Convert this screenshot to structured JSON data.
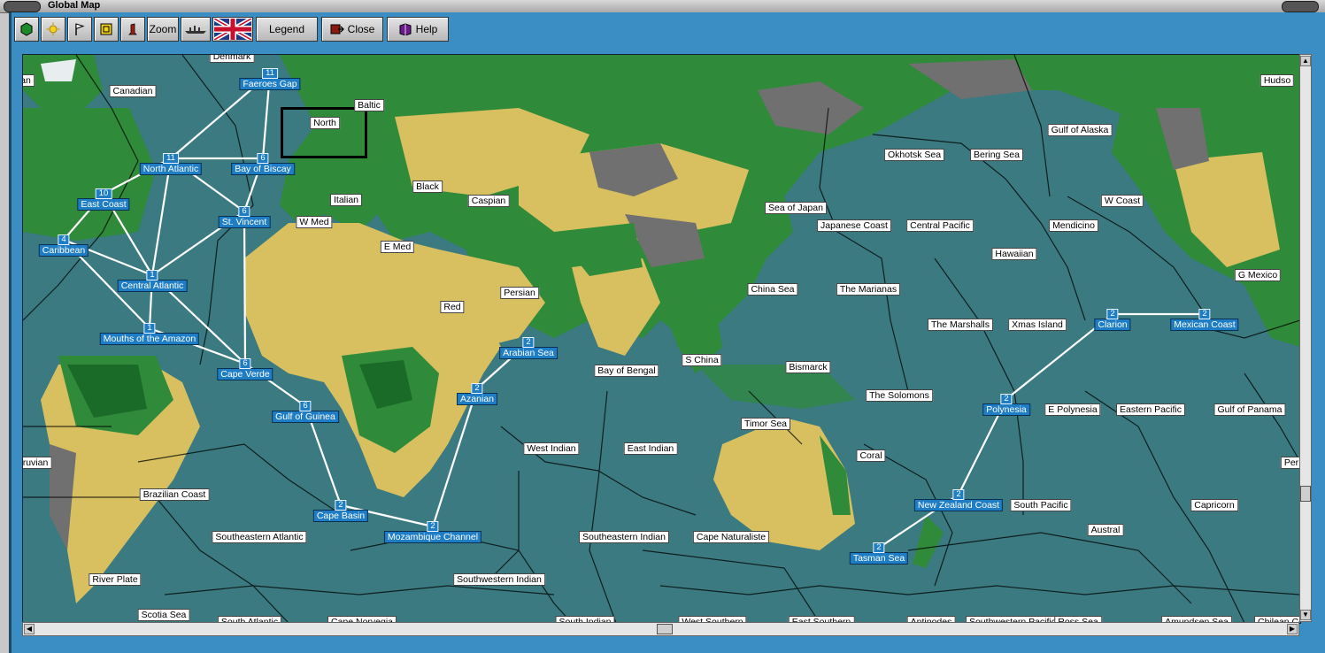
{
  "window": {
    "title": "Global Map"
  },
  "toolbar": {
    "zoom_label": "Zoom",
    "legend_label": "Legend",
    "close_label": "Close",
    "help_label": "Help"
  },
  "colors": {
    "frame": "#3b8ec4",
    "ocean": "#3a7a80",
    "route": "#ffffff",
    "zone_blue": "#1e7dc4"
  },
  "map": {
    "plain_labels": [
      {
        "text": "Denmark"
      },
      {
        "text": "Canadian"
      },
      {
        "text": "Baltic"
      },
      {
        "text": "North"
      },
      {
        "text": "Black"
      },
      {
        "text": "Italian"
      },
      {
        "text": "Caspian"
      },
      {
        "text": "W Med"
      },
      {
        "text": "E Med"
      },
      {
        "text": "Persian"
      },
      {
        "text": "Red"
      },
      {
        "text": "Okhotsk Sea"
      },
      {
        "text": "Bering Sea"
      },
      {
        "text": "Gulf of Alaska"
      },
      {
        "text": "Sea of Japan"
      },
      {
        "text": "Japanese Coast"
      },
      {
        "text": "Central Pacific"
      },
      {
        "text": "Mendicino"
      },
      {
        "text": "W Coast"
      },
      {
        "text": "Hawaiian"
      },
      {
        "text": "China Sea"
      },
      {
        "text": "The Marianas"
      },
      {
        "text": "The Marshalls"
      },
      {
        "text": "Xmas Island"
      },
      {
        "text": "G Mexico"
      },
      {
        "text": "Hudso"
      },
      {
        "text": "Bay of Bengal"
      },
      {
        "text": "S China"
      },
      {
        "text": "Bismarck"
      },
      {
        "text": "The Solomons"
      },
      {
        "text": "Timor Sea"
      },
      {
        "text": "E Polynesia"
      },
      {
        "text": "Eastern Pacific"
      },
      {
        "text": "Gulf of Panama"
      },
      {
        "text": "West Indian"
      },
      {
        "text": "East Indian"
      },
      {
        "text": "Coral"
      },
      {
        "text": "Brazilian Coast"
      },
      {
        "text": "South Pacific"
      },
      {
        "text": "Capricorn"
      },
      {
        "text": "Southeastern Atlantic"
      },
      {
        "text": "Southeastern Indian"
      },
      {
        "text": "Cape Naturaliste"
      },
      {
        "text": "Austral"
      },
      {
        "text": "River Plate"
      },
      {
        "text": "Southwestern Indian"
      },
      {
        "text": "Scotia Sea"
      },
      {
        "text": "South Atlantic"
      },
      {
        "text": "Cape Norvegia"
      },
      {
        "text": "South Indian"
      },
      {
        "text": "West Southern"
      },
      {
        "text": "East Southern"
      },
      {
        "text": "Antipodes"
      },
      {
        "text": "Southwestern Pacific"
      },
      {
        "text": "Ross Sea"
      },
      {
        "text": "Amundsen Sea"
      },
      {
        "text": "Chilean Coast"
      },
      {
        "text": "ruvian"
      },
      {
        "text": "Per"
      },
      {
        "text": "an"
      }
    ],
    "zones": [
      {
        "name": "Faeroes Gap",
        "count": "11"
      },
      {
        "name": "North Atlantic",
        "count": "11"
      },
      {
        "name": "Bay of Biscay",
        "count": "6"
      },
      {
        "name": "East Coast",
        "count": "10"
      },
      {
        "name": "St. Vincent",
        "count": "6"
      },
      {
        "name": "Caribbean",
        "count": "4"
      },
      {
        "name": "Central Atlantic",
        "count": "1"
      },
      {
        "name": "Mouths of the Amazon",
        "count": "1"
      },
      {
        "name": "Cape Verde",
        "count": "6"
      },
      {
        "name": "Gulf of Guinea",
        "count": "6"
      },
      {
        "name": "Cape Basin",
        "count": "2"
      },
      {
        "name": "Mozambique Channel",
        "count": "2"
      },
      {
        "name": "Arabian Sea",
        "count": "2"
      },
      {
        "name": "Azanian",
        "count": "2"
      },
      {
        "name": "Clarion",
        "count": "2"
      },
      {
        "name": "Mexican Coast",
        "count": "2"
      },
      {
        "name": "Polynesia",
        "count": "2"
      },
      {
        "name": "New Zealand Coast",
        "count": "2"
      },
      {
        "name": "Tasman Sea",
        "count": "2"
      }
    ]
  }
}
